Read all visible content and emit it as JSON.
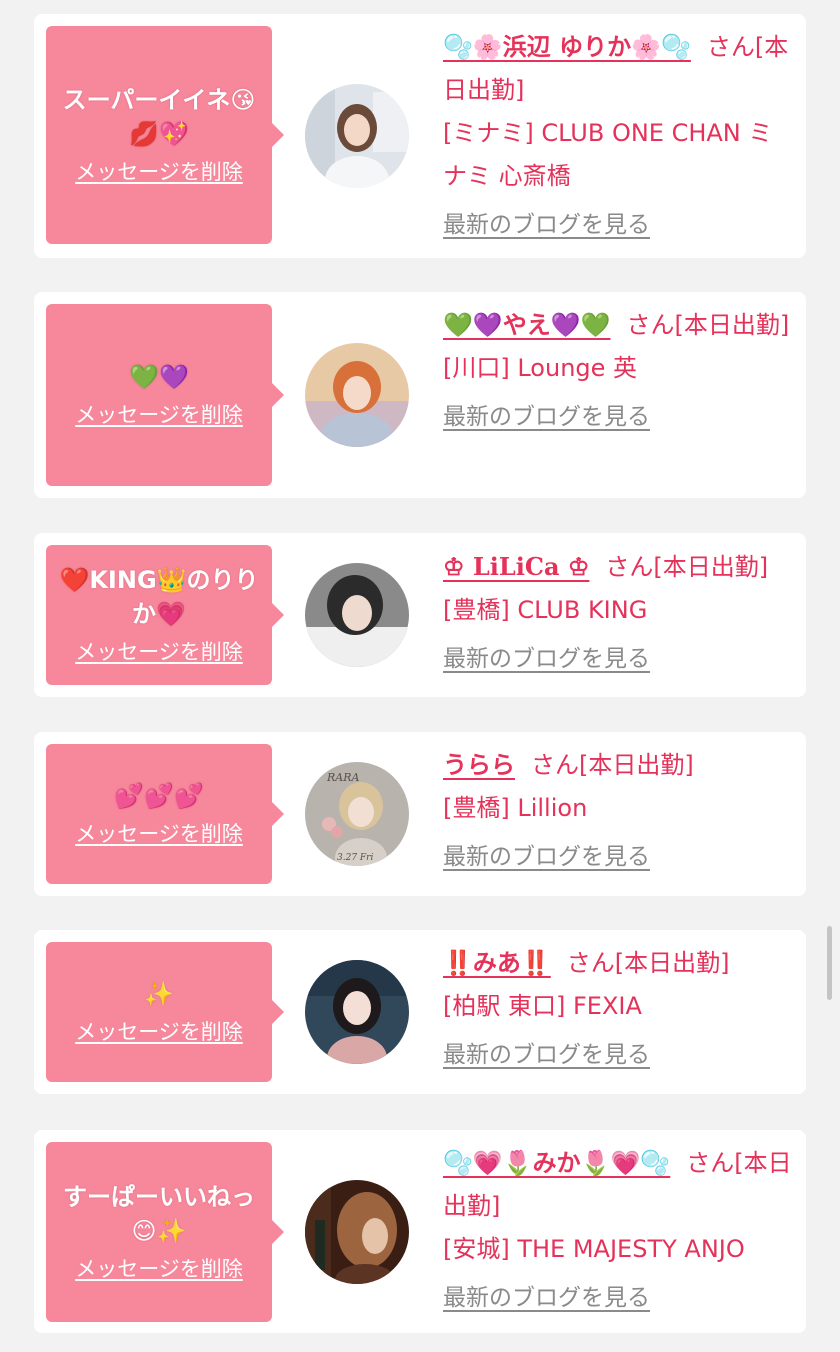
{
  "common": {
    "delete_label": "メッセージを削除",
    "san_label": "さん",
    "today_label": "[本日出勤]",
    "blog_label": "最新のブログを見る"
  },
  "colors": {
    "bubble": "#f7889c",
    "accent": "#e4325a",
    "muted": "#8a8a8a"
  },
  "items": [
    {
      "message": "スーパーイイネ😘💋💖",
      "cast_name": "🫧🌸浜辺 ゆりか🌸🫧",
      "shop": "[ミナミ] CLUB ONE CHAN ミナミ 心斎橋",
      "avatar_icon": "cast-photo"
    },
    {
      "message": "💚💜",
      "cast_name": "💚💜やえ💜💚",
      "shop": "[川口] Lounge 英",
      "avatar_icon": "cast-photo"
    },
    {
      "message": "❤️KING👑のりりか💗",
      "cast_name": "♔ LiLiCa ♔",
      "shop": "[豊橋] CLUB KING",
      "avatar_icon": "cast-photo"
    },
    {
      "message": "💕💕💕",
      "cast_name": "うらら",
      "shop": "[豊橋] Lillion",
      "avatar_icon": "cast-photo",
      "avatar_text": {
        "top": "RARA",
        "bottom": "3.27 Fri"
      }
    },
    {
      "message": "✨",
      "cast_name": "‼️みあ‼️",
      "shop": "[柏駅 東口] FEXIA",
      "avatar_icon": "cast-photo"
    },
    {
      "message": "すーぱーいいねっ😊✨",
      "cast_name": "🫧💗🌷みか🌷💗🫧",
      "shop": "[安城] THE MAJESTY ANJO",
      "avatar_icon": "cast-photo"
    }
  ]
}
